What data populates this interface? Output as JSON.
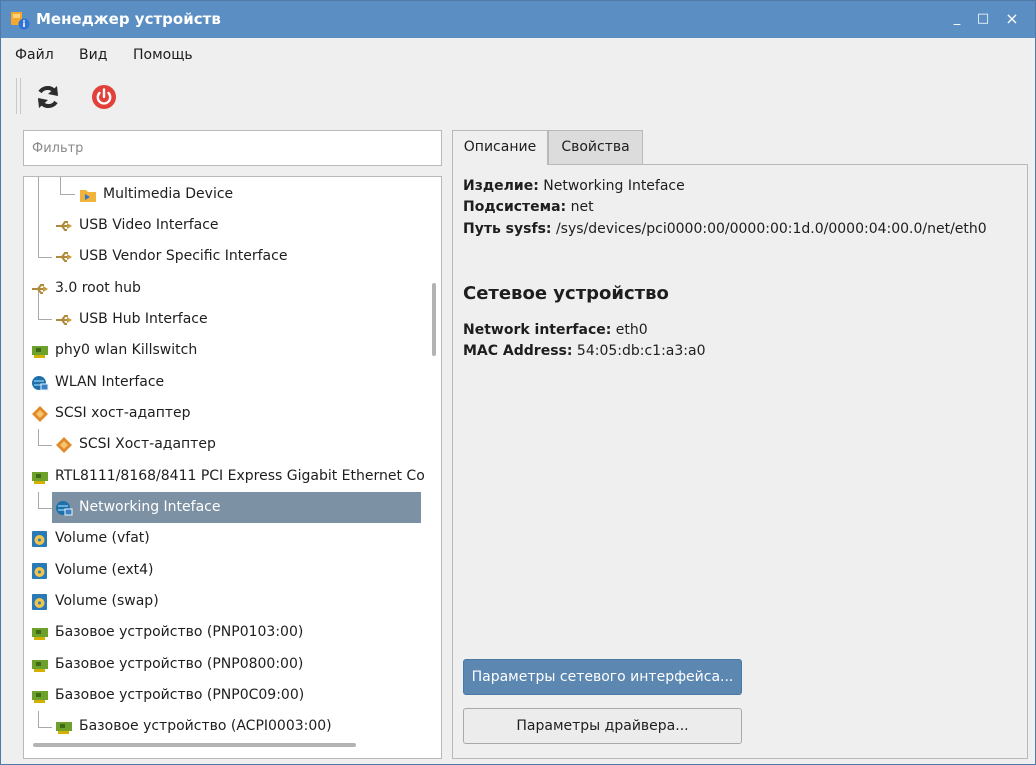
{
  "window": {
    "title": "Менеджер устройств",
    "controls": {
      "minimize": "_",
      "maximize": "□",
      "close": "×"
    }
  },
  "menu": [
    {
      "label": "Файл"
    },
    {
      "label": "Вид"
    },
    {
      "label": "Помощь"
    }
  ],
  "toolbar": {
    "refresh_icon": "refresh-icon",
    "power_icon": "power-icon"
  },
  "filter": {
    "placeholder": "Фильтр",
    "value": ""
  },
  "tree": {
    "items": [
      {
        "label": "Multimedia Device",
        "icon": "multimedia-device-icon"
      },
      {
        "label": "USB Video Interface",
        "icon": "usb-icon"
      },
      {
        "label": "USB Vendor Specific Interface",
        "icon": "usb-icon"
      },
      {
        "label": "3.0 root hub",
        "icon": "usb-icon"
      },
      {
        "label": "USB Hub Interface",
        "icon": "usb-icon"
      },
      {
        "label": "phy0 wlan Killswitch",
        "icon": "pci-card-icon"
      },
      {
        "label": "WLAN Interface",
        "icon": "network-icon"
      },
      {
        "label": "SCSI хост-адаптер",
        "icon": "scsi-icon"
      },
      {
        "label": "SCSI Хост-адаптер",
        "icon": "scsi-icon"
      },
      {
        "label": "RTL8111/8168/8411 PCI Express Gigabit Ethernet Co",
        "icon": "pci-card-icon"
      },
      {
        "label": "Networking Inteface",
        "icon": "network-icon",
        "selected": true
      },
      {
        "label": "Volume (vfat)",
        "icon": "volume-icon"
      },
      {
        "label": "Volume (ext4)",
        "icon": "volume-icon"
      },
      {
        "label": "Volume (swap)",
        "icon": "volume-icon"
      },
      {
        "label": "Базовое устройство (PNP0103:00)",
        "icon": "pci-card-icon"
      },
      {
        "label": "Базовое устройство (PNP0800:00)",
        "icon": "pci-card-icon"
      },
      {
        "label": "Базовое устройство (PNP0C09:00)",
        "icon": "pci-card-icon"
      },
      {
        "label": "Базовое устройство (ACPI0003:00)",
        "icon": "pci-card-icon"
      }
    ]
  },
  "tabs": [
    {
      "label": "Описание",
      "active": true
    },
    {
      "label": "Свойства",
      "active": false
    }
  ],
  "details": {
    "product_label": "Изделие:",
    "product_value": "Networking Inteface",
    "subsystem_label": "Подсистема:",
    "subsystem_value": "net",
    "sysfs_label": "Путь sysfs:",
    "sysfs_value": "/sys/devices/pci0000:00/0000:00:1d.0/0000:04:00.0/net/eth0",
    "section_title": "Сетевое устройство",
    "iface_label": "Network interface:",
    "iface_value": "eth0",
    "mac_label": "MAC Address:",
    "mac_value": "54:05:db:c1:a3:a0",
    "net_params_button": "Параметры сетевого интерфейса...",
    "driver_params_button": "Параметры драйвера..."
  },
  "colors": {
    "titlebar": "#5b8fc3",
    "selection": "#7d91a4",
    "primary_button": "#5b87b1",
    "power_red": "#e2403a"
  }
}
